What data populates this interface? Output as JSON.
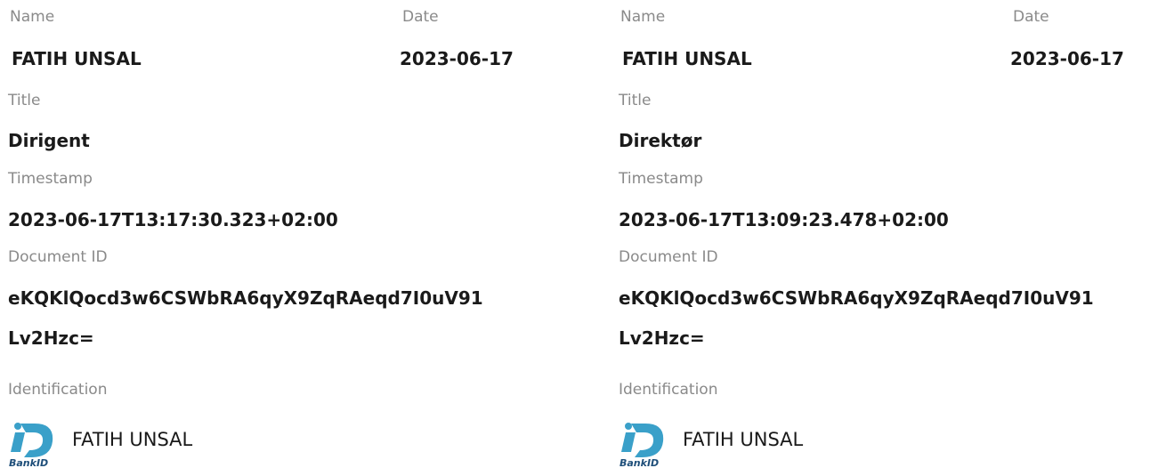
{
  "labels": {
    "name": "Name",
    "date": "Date",
    "title": "Title",
    "timestamp": "Timestamp",
    "document_id": "Document ID",
    "identification": "Identification"
  },
  "signatures": [
    {
      "name": "FATIH UNSAL",
      "date": "2023-06-17",
      "title": "Dirigent",
      "timestamp": "2023-06-17T13:17:30.323+02:00",
      "document_id_line1": "eKQKlQocd3w6CSWbRA6qyX9ZqRAeqd7I0uV91",
      "document_id_line2": "Lv2Hzc=",
      "identification_name": "FATIH UNSAL",
      "identification_method": "BankID"
    },
    {
      "name": "FATIH UNSAL",
      "date": "2023-06-17",
      "title": "Direktør",
      "timestamp": "2023-06-17T13:09:23.478+02:00",
      "document_id_line1": "eKQKlQocd3w6CSWbRA6qyX9ZqRAeqd7I0uV91",
      "document_id_line2": "Lv2Hzc=",
      "identification_name": "FATIH UNSAL",
      "identification_method": "BankID"
    }
  ],
  "colors": {
    "bankid_blue": "#3aa0c9",
    "bankid_dark": "#1e4e79",
    "label_gray": "#8a8a8a"
  }
}
